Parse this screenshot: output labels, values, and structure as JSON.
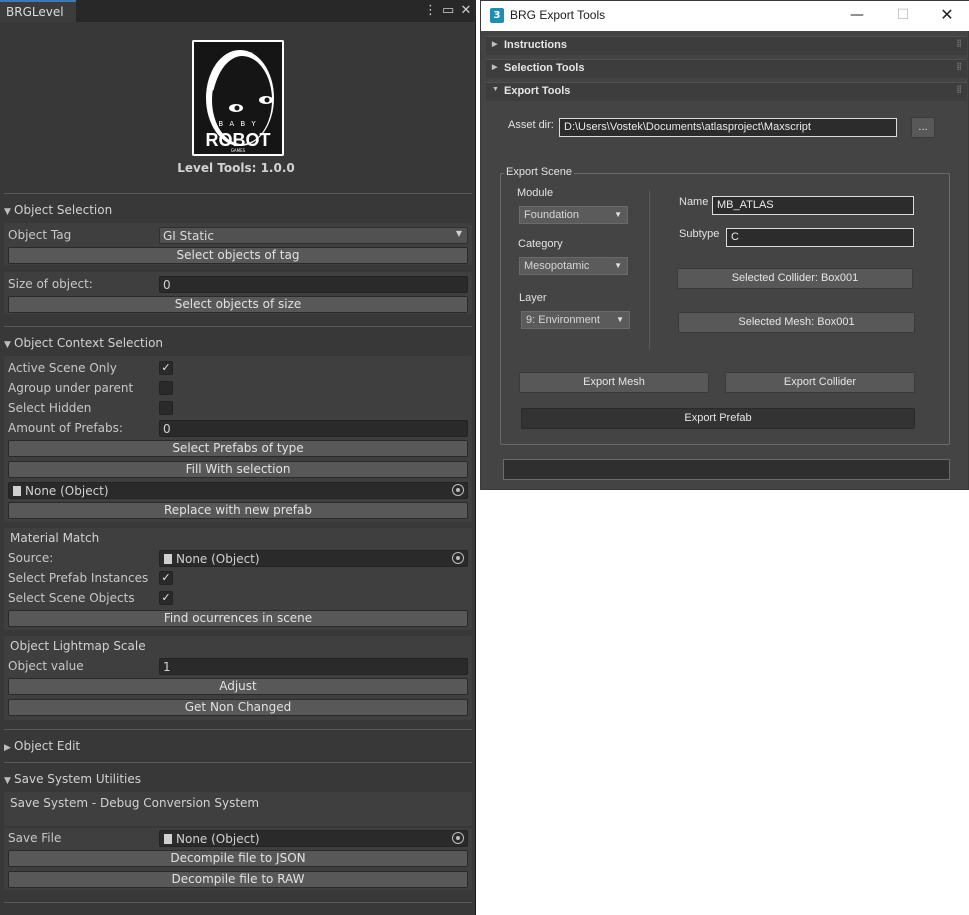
{
  "unity": {
    "tab_label": "BRGLevel",
    "logo": {
      "small_text": "B A B Y",
      "big_text": "ROBOT",
      "tiny_text": "GAMES"
    },
    "version": "Level Tools: 1.0.0",
    "object_selection": {
      "header": "Object Selection",
      "object_tag_label": "Object Tag",
      "object_tag_value": "GI Static",
      "select_tag_button": "Select objects of tag",
      "size_label": "Size of object:",
      "size_value": "0",
      "select_size_button": "Select objects of size"
    },
    "context_selection": {
      "header": "Object Context Selection",
      "active_scene_label": "Active Scene Only",
      "active_scene_checked": true,
      "agroup_label": "Agroup under parent",
      "agroup_checked": false,
      "select_hidden_label": "Select Hidden",
      "select_hidden_checked": false,
      "amount_label": "Amount of Prefabs:",
      "amount_value": "0",
      "select_prefabs_button": "Select Prefabs of type",
      "fill_button": "Fill With selection",
      "object_field": "None (Object)",
      "replace_button": "Replace with new prefab"
    },
    "material_match": {
      "header": "Material Match",
      "source_label": "Source:",
      "source_value": "None (Object)",
      "prefab_instances_label": "Select Prefab Instances",
      "prefab_instances_checked": true,
      "scene_objects_label": "Select Scene Objects",
      "scene_objects_checked": true,
      "find_button": "Find ocurrences in scene"
    },
    "lightmap": {
      "header": "Object Lightmap Scale",
      "value_label": "Object value",
      "value": "1",
      "adjust_button": "Adjust",
      "non_changed_button": "Get Non Changed"
    },
    "object_edit_header": "Object Edit",
    "save_system": {
      "header": "Save System Utilities",
      "subheader": "Save System - Debug Conversion System",
      "save_file_label": "Save File",
      "save_file_value": "None (Object)",
      "json_button": "Decompile file to JSON",
      "raw_button": "Decompile file to RAW"
    }
  },
  "max": {
    "app_icon": "3",
    "title": "BRG Export Tools",
    "rollouts": {
      "instructions": "Instructions",
      "selection": "Selection Tools",
      "export": "Export Tools"
    },
    "asset_dir_label": "Asset dir:",
    "asset_dir_value": "D:\\Users\\Vostek\\Documents\\atlasproject\\Maxscript",
    "browse_button": "...",
    "export_scene_label": "Export Scene",
    "module_label": "Module",
    "module_value": "Foundation",
    "category_label": "Category",
    "category_value": "Mesopotamic",
    "layer_label": "Layer",
    "layer_value": "9: Environment",
    "name_label": "Name",
    "name_value": "MB_ATLAS",
    "subtype_label": "Subtype",
    "subtype_value": "C",
    "collider_button": "Selected Collider: Box001",
    "mesh_button": "Selected Mesh: Box001",
    "export_mesh_button": "Export Mesh",
    "export_collider_button": "Export Collider",
    "export_prefab_button": "Export Prefab"
  }
}
